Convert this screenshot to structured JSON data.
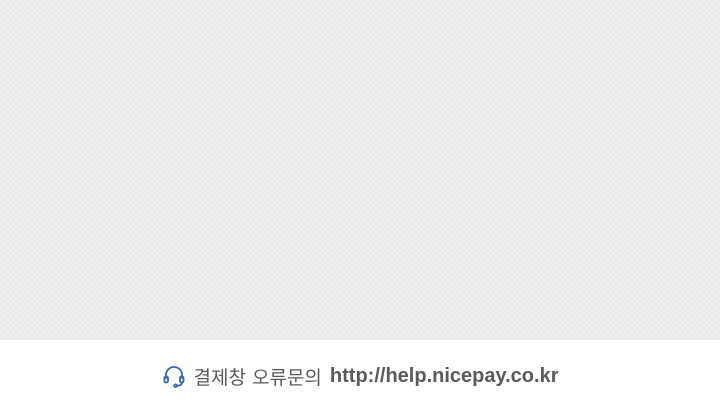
{
  "footer": {
    "icon": "headset-icon",
    "icon_color": "#3a64a8",
    "label": "결제창 오류문의",
    "url_text": "http://help.nicepay.co.kr"
  }
}
